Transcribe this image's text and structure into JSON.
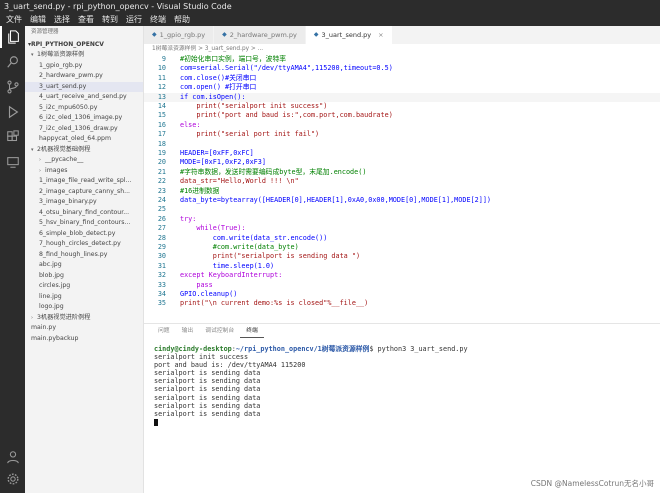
{
  "window": {
    "title": "3_uart_send.py - rpi_python_opencv - Visual Studio Code"
  },
  "menu": [
    "文件",
    "编辑",
    "选择",
    "查看",
    "转到",
    "运行",
    "终端",
    "帮助"
  ],
  "sidebar": {
    "header": "资源管理器",
    "root": "RPI_PYTHON_OPENCV",
    "items": [
      {
        "label": "1树莓派资源样例",
        "depth": 1,
        "type": "folder-open"
      },
      {
        "label": "1_gpio_rgb.py",
        "depth": 2
      },
      {
        "label": "2_hardware_pwm.py",
        "depth": 2
      },
      {
        "label": "3_uart_send.py",
        "depth": 2,
        "selected": true
      },
      {
        "label": "4_uart_receive_and_send.py",
        "depth": 2
      },
      {
        "label": "5_i2c_mpu6050.py",
        "depth": 2
      },
      {
        "label": "6_i2c_oled_1306_image.py",
        "depth": 2
      },
      {
        "label": "7_i2c_oled_1306_draw.py",
        "depth": 2
      },
      {
        "label": "happycat_oled_64.ppm",
        "depth": 2
      },
      {
        "label": "2机器视觉基础例程",
        "depth": 1,
        "type": "folder-open"
      },
      {
        "label": "__pycache__",
        "depth": 2,
        "type": "folder"
      },
      {
        "label": "images",
        "depth": 2,
        "type": "folder"
      },
      {
        "label": "1_image_file_read_write_spl...",
        "depth": 2
      },
      {
        "label": "2_image_capture_canny_sh...",
        "depth": 2
      },
      {
        "label": "3_image_binary.py",
        "depth": 2
      },
      {
        "label": "4_otsu_binary_find_contour...",
        "depth": 2
      },
      {
        "label": "5_hsv_binary_find_contours...",
        "depth": 2
      },
      {
        "label": "6_simple_blob_detect.py",
        "depth": 2
      },
      {
        "label": "7_hough_circles_detect.py",
        "depth": 2
      },
      {
        "label": "8_find_hough_lines.py",
        "depth": 2
      },
      {
        "label": "abc.jpg",
        "depth": 2
      },
      {
        "label": "blob.jpg",
        "depth": 2
      },
      {
        "label": "circles.jpg",
        "depth": 2
      },
      {
        "label": "line.jpg",
        "depth": 2
      },
      {
        "label": "logo.jpg",
        "depth": 2
      },
      {
        "label": "3机器视觉进阶例程",
        "depth": 1,
        "type": "folder"
      },
      {
        "label": "main.py",
        "depth": 1
      },
      {
        "label": "main.pybackup",
        "depth": 1
      }
    ]
  },
  "tabs": [
    {
      "label": "1_gpio_rgb.py",
      "active": false
    },
    {
      "label": "2_hardware_pwm.py",
      "active": false
    },
    {
      "label": "3_uart_send.py",
      "active": true
    }
  ],
  "breadcrumb": "1树莓派资源样例 > 3_uart_send.py > ...",
  "code": [
    {
      "n": "9",
      "text": "#初始化串口实例，端口号，波特率",
      "color": "#008000"
    },
    {
      "n": "10",
      "text": "com=serial.Serial(\"/dev/ttyAMA4\",115200,timeout=0.5)",
      "color": "#0000ff"
    },
    {
      "n": "11",
      "text": "com.close()#关闭串口",
      "color": "#0000ff"
    },
    {
      "n": "12",
      "text": "com.open() #打开串口",
      "color": "#0000ff"
    },
    {
      "n": "13",
      "text": "if com.isOpen():",
      "color": "#0000ff",
      "active": true
    },
    {
      "n": "14",
      "text": "    print(\"serialport init success\")",
      "color": "#a31515"
    },
    {
      "n": "15",
      "text": "    print(\"port and baud is:\",com.port,com.baudrate)",
      "color": "#a31515"
    },
    {
      "n": "16",
      "text": "else:",
      "color": "#af00db"
    },
    {
      "n": "17",
      "text": "    print(\"serial port init fail\")",
      "color": "#a31515"
    },
    {
      "n": "18",
      "text": "",
      "color": "#333"
    },
    {
      "n": "19",
      "text": "HEADER=[0xFF,0xFC]",
      "color": "#0000ff"
    },
    {
      "n": "20",
      "text": "MODE=[0xF1,0xF2,0xF3]",
      "color": "#0000ff"
    },
    {
      "n": "21",
      "text": "#字符串数据，发送时需要编码成byte型，末尾加.encode()",
      "color": "#008000"
    },
    {
      "n": "22",
      "text": "data_str=\"Hello,World !!! \\n\"",
      "color": "#a31515"
    },
    {
      "n": "23",
      "text": "#16进制数据",
      "color": "#008000"
    },
    {
      "n": "24",
      "text": "data_byte=bytearray([HEADER[0],HEADER[1],0xA0,0x00,MODE[0],MODE[1],MODE[2]])",
      "color": "#0000ff"
    },
    {
      "n": "25",
      "text": "",
      "color": "#333"
    },
    {
      "n": "26",
      "text": "try:",
      "color": "#af00db"
    },
    {
      "n": "27",
      "text": "    while(True):",
      "color": "#af00db"
    },
    {
      "n": "28",
      "text": "        com.write(data_str.encode())",
      "color": "#0000ff"
    },
    {
      "n": "29",
      "text": "        #com.write(data_byte)",
      "color": "#008000"
    },
    {
      "n": "30",
      "text": "        print(\"serialport is sending data \")",
      "color": "#a31515"
    },
    {
      "n": "31",
      "text": "        time.sleep(1.0)",
      "color": "#0000ff"
    },
    {
      "n": "32",
      "text": "except KeyboardInterrupt:",
      "color": "#af00db"
    },
    {
      "n": "33",
      "text": "    pass",
      "color": "#af00db"
    },
    {
      "n": "34",
      "text": "GPIO.cleanup()",
      "color": "#0000ff"
    },
    {
      "n": "35",
      "text": "print(\"\\n current demo:%s is closed\"%__file__)",
      "color": "#a31515"
    }
  ],
  "panel_tabs": [
    {
      "label": "问题",
      "active": false
    },
    {
      "label": "输出",
      "active": false
    },
    {
      "label": "调试控制台",
      "active": false
    },
    {
      "label": "终端",
      "active": true
    }
  ],
  "terminal": {
    "prompt_user": "cindy@cindy-desktop",
    "prompt_sep": ":",
    "prompt_path": "~/rpi_python_opencv/1树莓派资源样例",
    "prompt_end": "$ python3 3_uart_send.py",
    "output": [
      "serialport init success",
      "port and baud is: /dev/ttyAMA4 115200",
      "serialport is sending data",
      "serialport is sending data",
      "serialport is sending data",
      "serialport is sending data",
      "serialport is sending data",
      "serialport is sending data"
    ]
  },
  "watermark": "CSDN @NamelessCotrun无名小哥",
  "colors": {
    "activity_bar": "#2c2c2c",
    "sidebar": "#f3f3f3",
    "editor_bg": "#ffffff",
    "line_number": "#237893",
    "prompt_user": "#2a7a2a",
    "prompt_path": "#2d5aa8"
  },
  "icons": {
    "activity": [
      "files-icon",
      "search-icon",
      "source-control-icon",
      "run-debug-icon",
      "extensions-icon",
      "remote-explorer-icon",
      "account-icon",
      "settings-gear-icon"
    ]
  }
}
